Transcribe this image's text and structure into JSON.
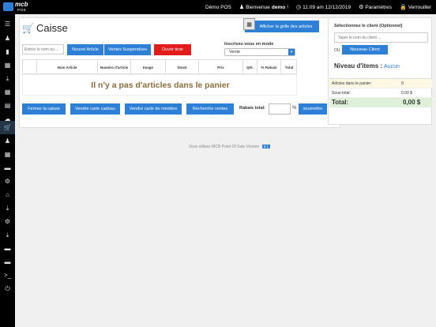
{
  "topbar": {
    "logo_main": "mcb",
    "logo_sub": "POS",
    "store_name": "Démo POS",
    "welcome_prefix": "Bienvenue",
    "user": "demo",
    "user_suffix": "!",
    "datetime": "11:09 am 12/12/2019",
    "settings_label": "Paramètres",
    "lock_label": "Verrouiller"
  },
  "sidebar": {
    "icons": [
      "menu-icon",
      "users-icon",
      "barcode-icon",
      "table-icon",
      "download-icon",
      "table-icon",
      "chart-icon",
      "cloud-download-icon",
      "cart-icon",
      "user-icon",
      "table-icon",
      "card-icon",
      "cogs-icon",
      "home-icon",
      "download-icon",
      "cog-icon",
      "download-icon",
      "card-icon",
      "card-icon",
      "terminal-icon",
      "power-icon"
    ],
    "active_index": 8
  },
  "sale": {
    "title": "Caisse",
    "grid_button": "Afficher la grille des articles",
    "search_placeholder": "Entrez le nom ou ...",
    "new_item": "Nouvel Article",
    "suspended": "Ventes Suspendues",
    "open_drawer": "Ouvrir tiroir",
    "mode_label": "Inscrivez-vous en mode",
    "mode_value": "Vente",
    "columns": [
      "Nom Article",
      "Numéro d'article",
      "Image",
      "Stock",
      "Prix",
      "Qté.",
      "% Rabais",
      "Total"
    ],
    "empty_message": "Il n'y a pas d'articles dans le panier",
    "close_register": "Fermer la caisse",
    "sell_gift_card": "Vendre carte cadeau",
    "sell_member_card": "Vendre carte de membre",
    "search_sales": "Recherche ventes",
    "discount_label": "Rabais total:",
    "discount_value": "",
    "percent": "%",
    "submit": "soumettre"
  },
  "customer": {
    "select_label": "Sélectionnez le client (Optionnel)",
    "input_placeholder": "Taper le nom du client ...",
    "or": "OU",
    "new_client": "Nouveau Client",
    "items_label": "Niveau d'items :",
    "items_value": "Aucun"
  },
  "summary": {
    "rows": [
      {
        "label": "Articles dans le panier:",
        "value": "0"
      },
      {
        "label": "Sous-total:",
        "value": "0,00 $"
      }
    ],
    "total_label": "Total:",
    "total_value": "0,00 $"
  },
  "footer": {
    "text": "Vous utilisez MCB Point Of Sale Version",
    "version": "8.1"
  },
  "colors": {
    "primary": "#2e7fd6",
    "danger": "#e21b1b",
    "sidebar_bg": "#000000",
    "empty_text": "#8a6d3b",
    "total_bg": "#dff0d8"
  }
}
